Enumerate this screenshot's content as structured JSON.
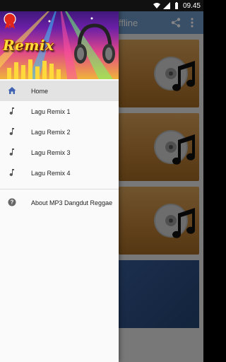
{
  "status_bar": {
    "time": "09.45"
  },
  "app_bar": {
    "title": "ffline"
  },
  "drawer": {
    "header_logo_text": "Remix",
    "items": [
      {
        "label": "Home",
        "icon": "home-icon",
        "active": true
      },
      {
        "label": "Lagu Remix 1",
        "icon": "music-note-icon"
      },
      {
        "label": "Lagu Remix 2",
        "icon": "music-note-icon"
      },
      {
        "label": "Lagu Remix 3",
        "icon": "music-note-icon"
      },
      {
        "label": "Lagu Remix 4",
        "icon": "music-note-icon"
      }
    ],
    "footer_items": [
      {
        "label": "About MP3 Dangdut Reggae",
        "icon": "help-icon"
      }
    ]
  },
  "colors": {
    "accent": "#3f62b3",
    "app_bar": "#6d98c8",
    "card": "#c2863e"
  }
}
